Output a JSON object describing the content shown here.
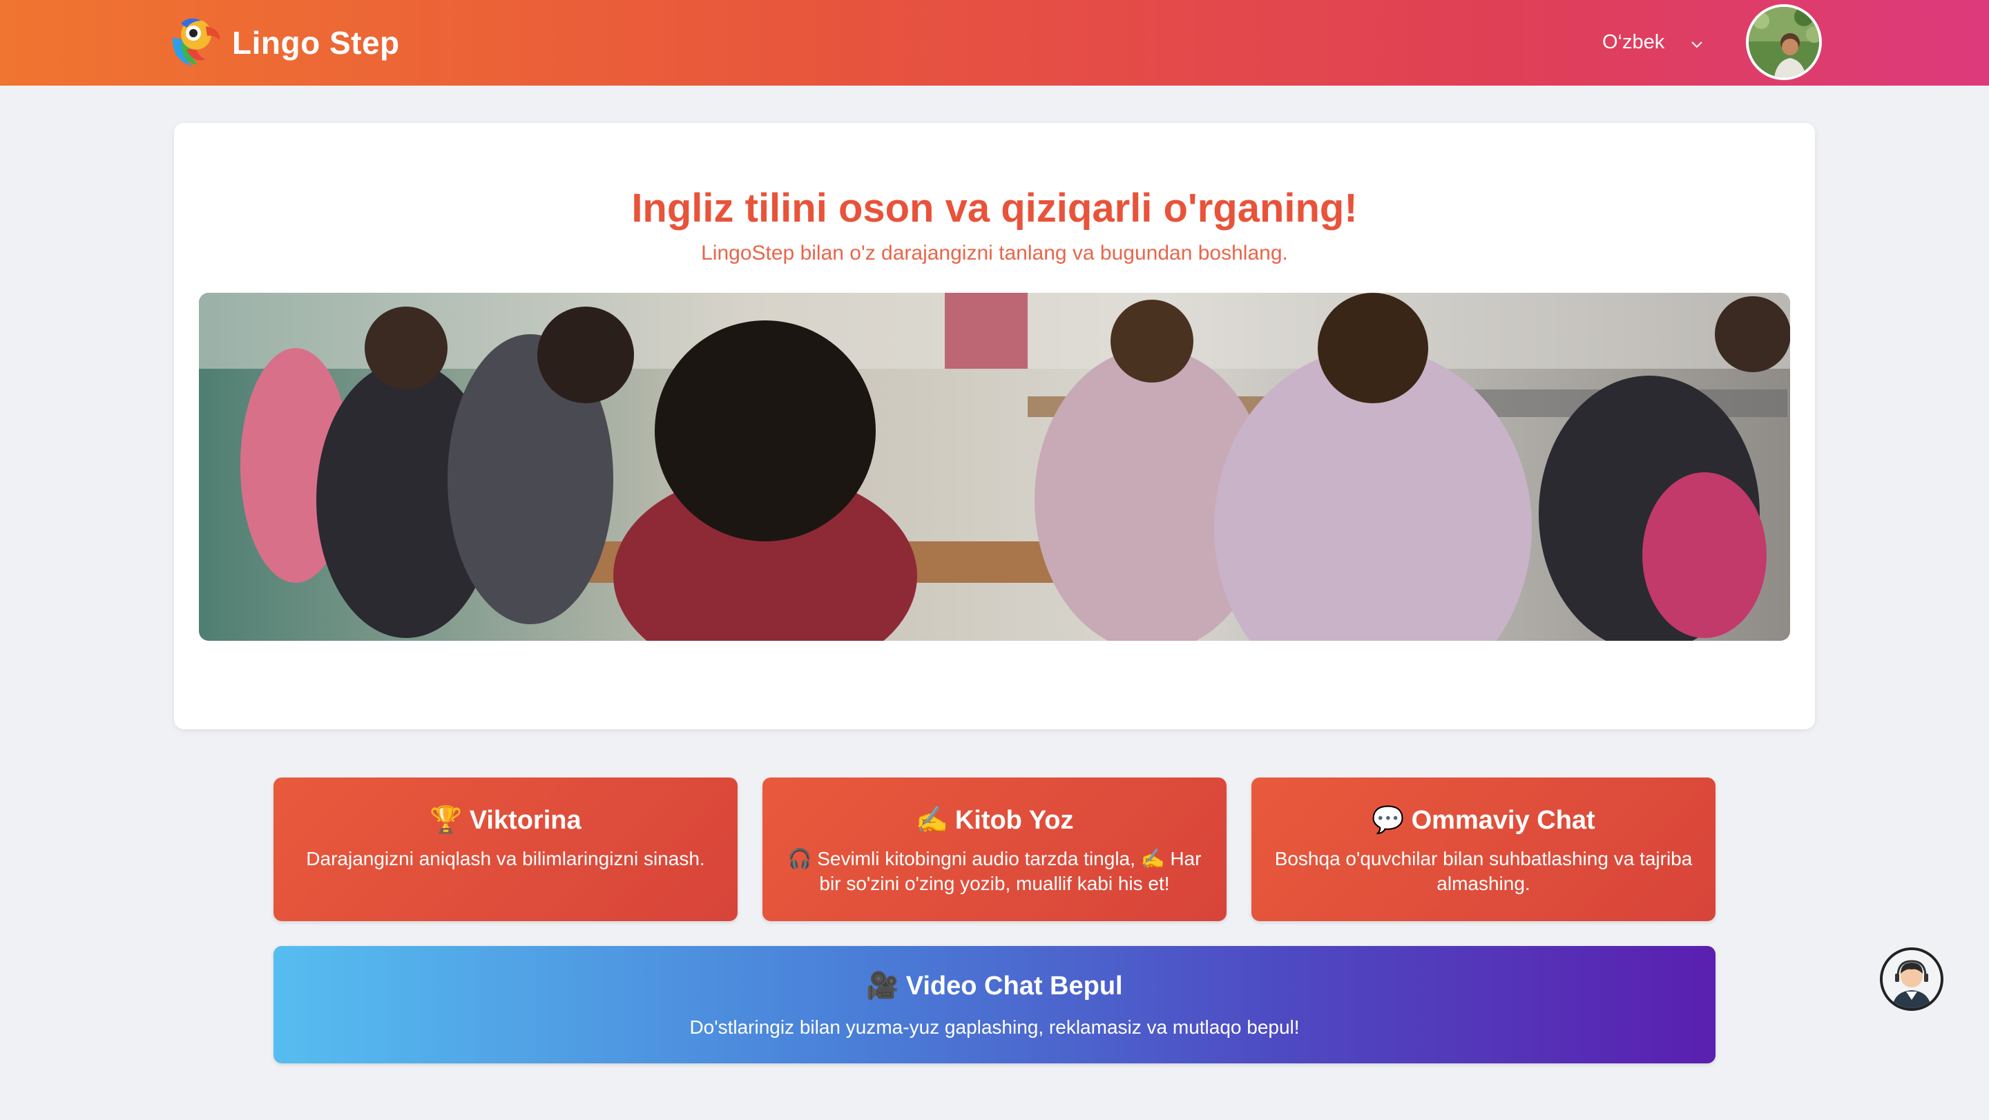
{
  "header": {
    "brand": "Lingo Step",
    "language": "O‘zbek",
    "icons": {
      "logo": "parrot-logo-icon",
      "chevron": "chevron-down-icon",
      "avatar": "user-avatar"
    }
  },
  "hero": {
    "title": "Ingliz tilini oson va qiziqarli o'rganing!",
    "subtitle": "LingoStep bilan o'z darajangizni tanlang va bugundan boshlang."
  },
  "features": [
    {
      "icon": "🏆",
      "icon_name": "trophy-icon",
      "title": "Viktorina",
      "desc": "Darajangizni aniqlash va bilimlaringizni sinash."
    },
    {
      "icon": "✍️",
      "icon_name": "writing-hand-icon",
      "title": "Kitob Yoz",
      "desc": "🎧 Sevimli kitobingni audio tarzda tingla, ✍️ Har bir so'zini o'zing yozib, muallif kabi his et!"
    },
    {
      "icon": "💬",
      "icon_name": "speech-bubble-icon",
      "title": "Ommaviy Chat",
      "desc": "Boshqa o'quvchilar bilan suhbatlashing va tajriba almashing."
    }
  ],
  "video": {
    "icon": "🎥",
    "icon_name": "video-camera-icon",
    "title": "Video Chat Bepul",
    "desc": "Do'stlaringiz bilan yuzma-yuz gaplashing, reklamasiz va mutlaqo bepul!"
  },
  "colors": {
    "header_start": "#f07530",
    "header_end": "#dc3a7c",
    "accent": "#e8533a",
    "feature_card": "#e0503a",
    "video_start": "#56bdf0",
    "video_end": "#5a1fb0"
  }
}
